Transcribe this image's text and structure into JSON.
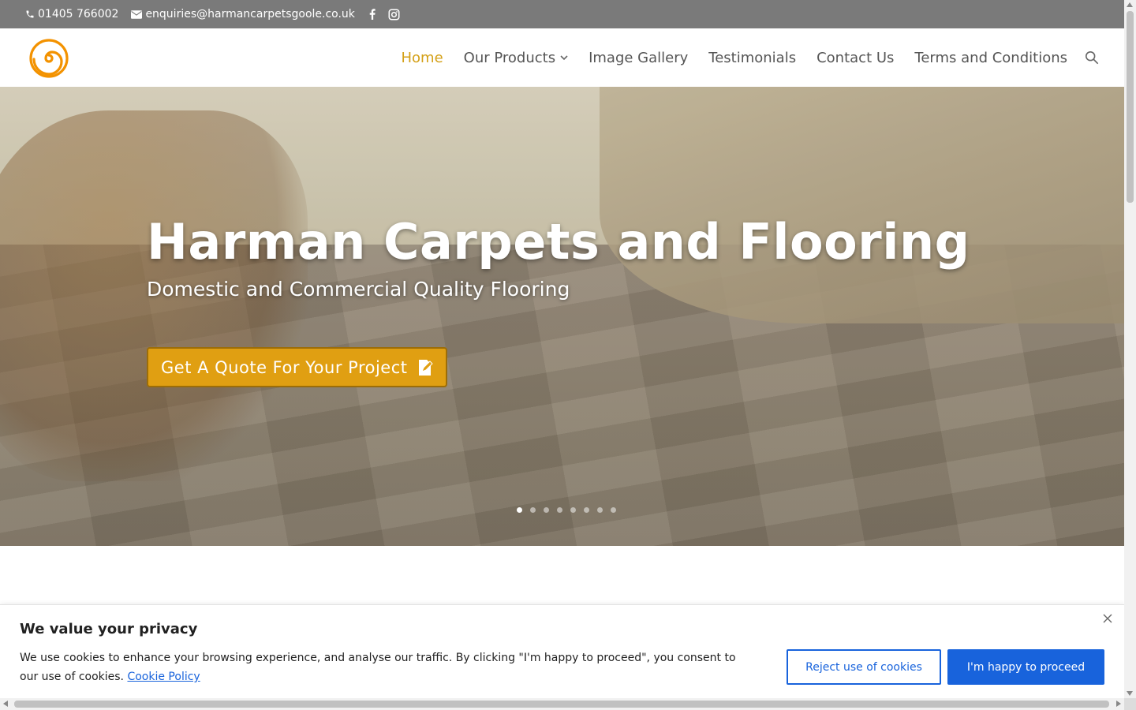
{
  "topbar": {
    "phone": "01405 766002",
    "email": "enquiries@harmancarpetsgoole.co.uk",
    "icons": [
      "phone-icon",
      "email-icon",
      "facebook-icon",
      "instagram-icon"
    ]
  },
  "header": {
    "logo_icon": "spiral-logo-icon",
    "nav": [
      {
        "label": "Home",
        "active": true
      },
      {
        "label": "Our Products",
        "has_dropdown": true
      },
      {
        "label": "Image Gallery"
      },
      {
        "label": "Testimonials"
      },
      {
        "label": "Contact Us"
      },
      {
        "label": "Terms and Conditions"
      }
    ],
    "search_icon": "search-icon"
  },
  "hero": {
    "title": "Harman Carpets and Flooring",
    "subtitle": "Domestic and Commercial Quality Flooring",
    "cta_label": "Get A Quote For Your Project",
    "cta_icon": "edit-document-icon",
    "slide_count": 8,
    "active_slide": 1
  },
  "cookie_banner": {
    "title": "We value your privacy",
    "text": "We use cookies to enhance your browsing experience, and analyse our traffic. By clicking \"I'm happy to proceed\", you consent to our use of cookies.",
    "policy_link": "Cookie Policy",
    "reject_label": "Reject use of cookies",
    "accept_label": "I'm happy to proceed",
    "close_icon": "close-icon"
  },
  "colors": {
    "topbar_bg": "#7a7a7a",
    "accent": "#d4a017",
    "cta_bg": "#e09f12",
    "cookie_blue": "#1863dc",
    "logo_orange": "#f39200"
  }
}
